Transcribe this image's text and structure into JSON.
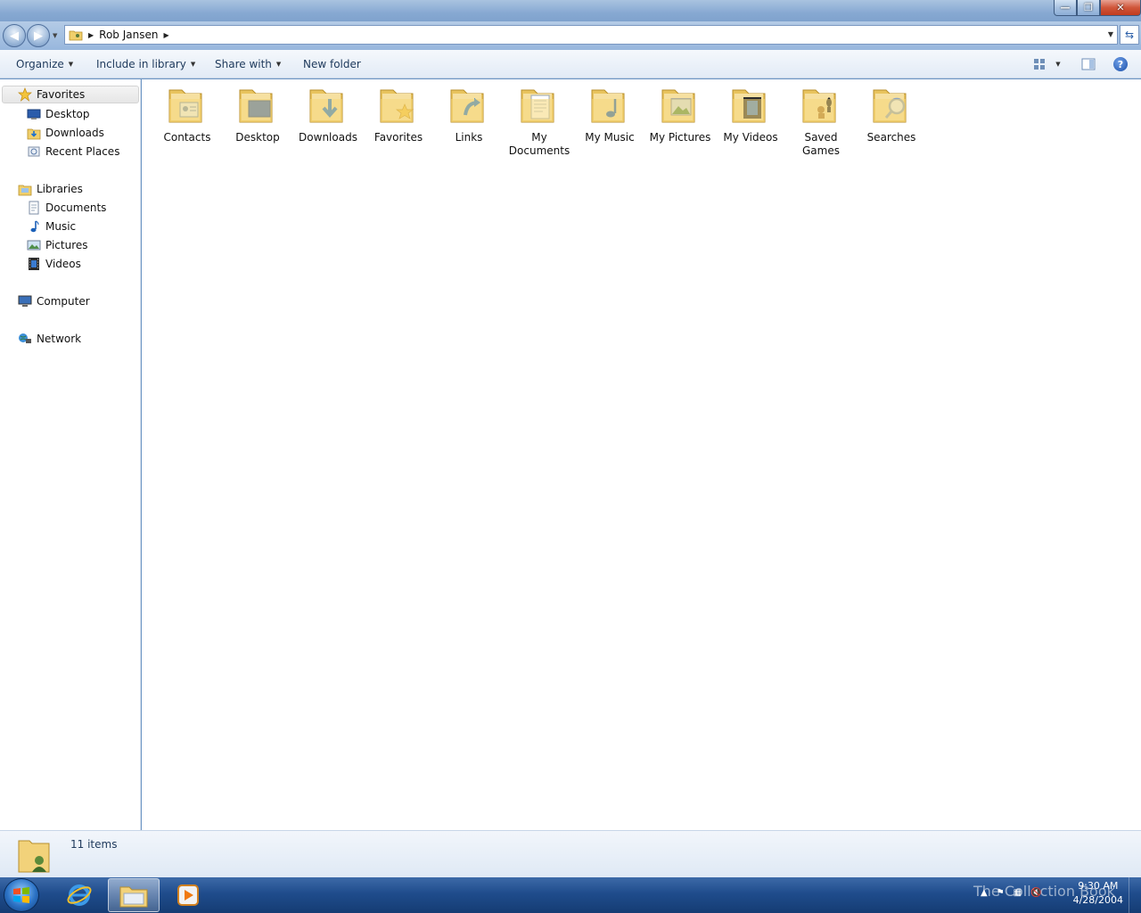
{
  "window": {
    "minimize_glyph": "—",
    "maximize_glyph": "❐",
    "close_glyph": "✕"
  },
  "address": {
    "breadcrumb": [
      "Rob Jansen"
    ]
  },
  "toolbar": {
    "organize": "Organize",
    "include_in_library": "Include in library",
    "share_with": "Share with",
    "new_folder": "New folder",
    "help_glyph": "?"
  },
  "sidebar": {
    "favorites": {
      "label": "Favorites",
      "items": [
        {
          "label": "Desktop",
          "icon": "desktop-icon"
        },
        {
          "label": "Downloads",
          "icon": "downloads-icon"
        },
        {
          "label": "Recent Places",
          "icon": "recent-places-icon"
        }
      ]
    },
    "libraries": {
      "label": "Libraries",
      "items": [
        {
          "label": "Documents",
          "icon": "documents-icon"
        },
        {
          "label": "Music",
          "icon": "music-icon"
        },
        {
          "label": "Pictures",
          "icon": "pictures-icon"
        },
        {
          "label": "Videos",
          "icon": "videos-icon"
        }
      ]
    },
    "computer": "Computer",
    "network": "Network"
  },
  "folders": [
    {
      "label": "Contacts",
      "icon": "contacts-folder-icon"
    },
    {
      "label": "Desktop",
      "icon": "desktop-folder-icon"
    },
    {
      "label": "Downloads",
      "icon": "downloads-folder-icon"
    },
    {
      "label": "Favorites",
      "icon": "favorites-folder-icon"
    },
    {
      "label": "Links",
      "icon": "links-folder-icon"
    },
    {
      "label": "My Documents",
      "icon": "my-documents-folder-icon"
    },
    {
      "label": "My Music",
      "icon": "my-music-folder-icon"
    },
    {
      "label": "My Pictures",
      "icon": "my-pictures-folder-icon"
    },
    {
      "label": "My Videos",
      "icon": "my-videos-folder-icon"
    },
    {
      "label": "Saved Games",
      "icon": "saved-games-folder-icon"
    },
    {
      "label": "Searches",
      "icon": "searches-folder-icon"
    }
  ],
  "status": {
    "items_text": "11 items"
  },
  "taskbar": {
    "time": "9:30 AM",
    "date": "4/28/2004",
    "watermark": "The Collection Book"
  },
  "colors": {
    "folder_yellow": "#f5d77a",
    "accent_blue": "#2a6fc9",
    "toolbar_text": "#1e395b"
  }
}
